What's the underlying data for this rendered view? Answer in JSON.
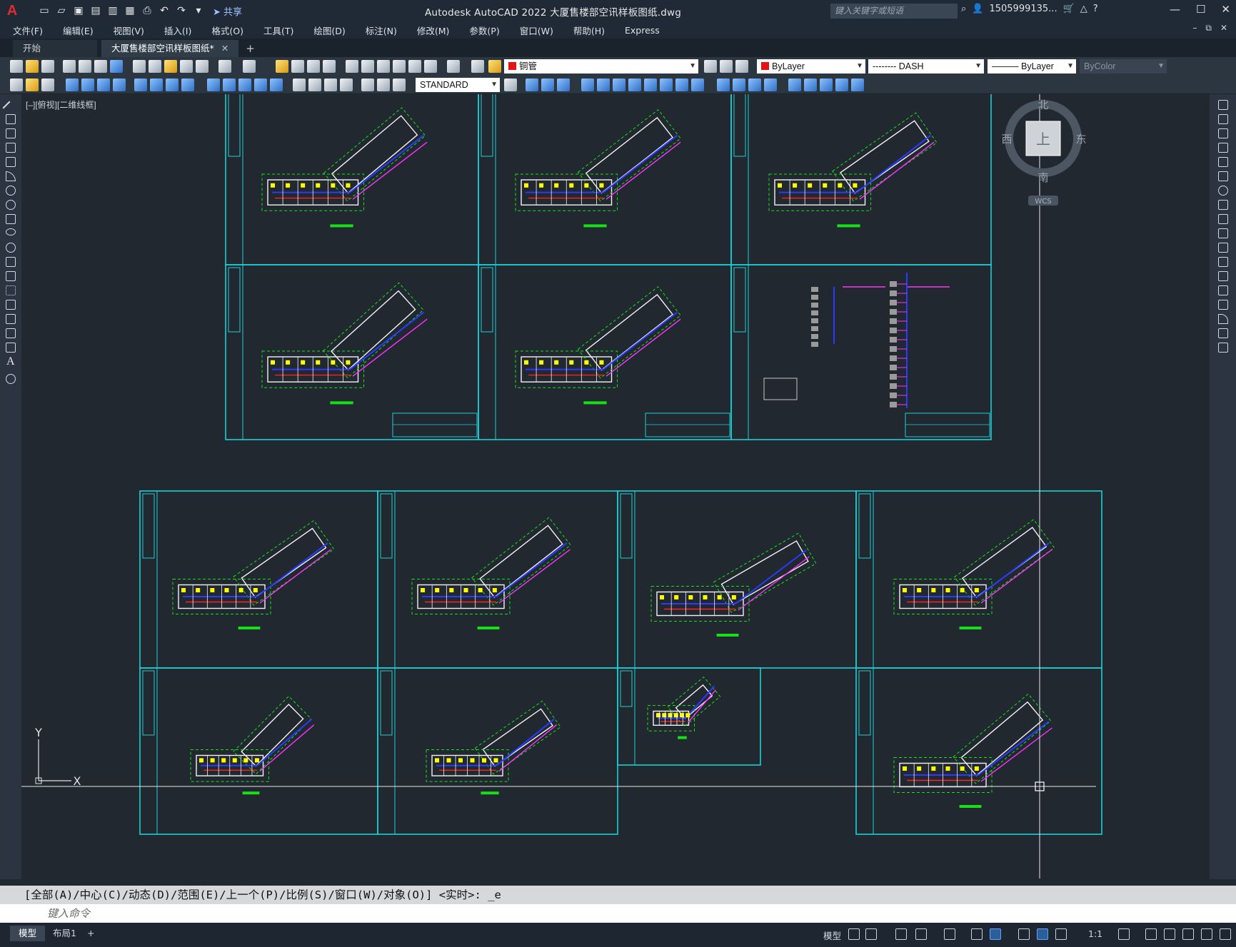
{
  "app": {
    "logo": "A",
    "window_title": "Autodesk AutoCAD 2022    大厦售楼部空讯样板图纸.dwg",
    "share_label": "共享",
    "search_placeholder": "键入关键字或短语",
    "user": "1505999135...",
    "window_controls": [
      "—",
      "☐",
      "✕"
    ]
  },
  "menu": {
    "items": [
      "文件(F)",
      "编辑(E)",
      "视图(V)",
      "插入(I)",
      "格式(O)",
      "工具(T)",
      "绘图(D)",
      "标注(N)",
      "修改(M)",
      "参数(P)",
      "窗口(W)",
      "帮助(H)",
      "Express"
    ],
    "doc_controls": [
      "–",
      "⧉",
      "✕"
    ]
  },
  "tabs": {
    "start": "开始",
    "active": "大厦售楼部空讯样板图纸*",
    "close": "✕",
    "add": "+"
  },
  "toolbar": {
    "layer_value": "铜管",
    "color_value": "ByLayer",
    "linetype_value": "-------- DASH",
    "lineweight_value": "ByLayer",
    "plotstyle_value": "ByColor",
    "textstyle_value": "STANDARD"
  },
  "viewport": {
    "label": "[–][俯视][二维线框]",
    "compass": {
      "north": "北",
      "south": "南",
      "east": "东",
      "west": "西",
      "top": "上",
      "wcs": "WCS"
    },
    "ucs": {
      "x": "X",
      "y": "Y"
    }
  },
  "colors": {
    "frame": "#1ccfd4",
    "wall": "#f2f2f2",
    "green": "#18e018",
    "blue": "#2a3aff",
    "red": "#ff2020",
    "magenta": "#ff33ff",
    "yellow": "#ffff00"
  },
  "command": {
    "history": "[全部(A)/中心(C)/动态(D)/范围(E)/上一个(P)/比例(S)/窗口(W)/对象(O)] <实时>: _e",
    "placeholder": "键入命令"
  },
  "status": {
    "model_tab": "模型",
    "layout_tab": "布局1",
    "add": "+",
    "model_label": "模型",
    "scale": "1:1"
  }
}
